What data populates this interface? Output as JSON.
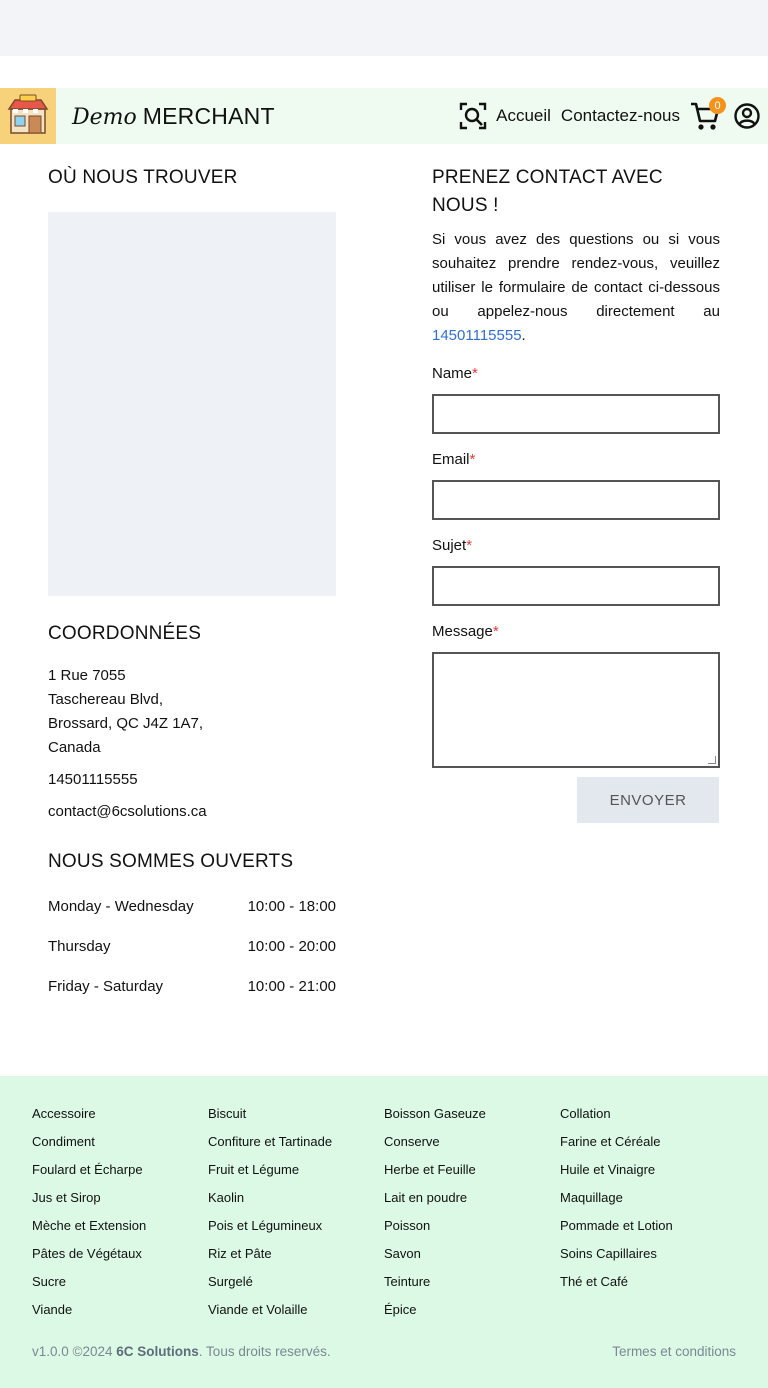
{
  "header": {
    "brand_script": "Demo",
    "brand_name": "MERCHANT",
    "nav": {
      "home": "Accueil",
      "contact": "Contactez-nous"
    },
    "cart_count": "0",
    "icons": [
      "store-logo-icon",
      "search-icon",
      "cart-icon",
      "account-icon"
    ]
  },
  "location": {
    "title": "OÙ NOUS TROUVER"
  },
  "coordinates": {
    "title": "COORDONNÉES",
    "address_line1": "1 Rue 7055",
    "address_line2": "Taschereau Blvd,",
    "address_line3": "Brossard, QC J4Z 1A7,",
    "address_line4": "Canada",
    "phone": "14501115555",
    "email": "contact@6csolutions.ca"
  },
  "hours": {
    "title": "NOUS SOMMES OUVERTS",
    "rows": [
      {
        "days": "Monday - Wednesday",
        "time": "10:00 - 18:00"
      },
      {
        "days": "Thursday",
        "time": "10:00 - 20:00"
      },
      {
        "days": "Friday - Saturday",
        "time": "10:00 - 21:00"
      }
    ]
  },
  "contact_form": {
    "title": "PRENEZ CONTACT AVEC NOUS !",
    "intro_text": "Si vous avez des questions ou si vous souhaitez prendre rendez-vous, veuillez utiliser le formulaire de contact ci-dessous ou appelez-nous directement au",
    "intro_phone": "14501115555",
    "intro_end": ".",
    "fields": {
      "name_label": "Name",
      "email_label": "Email",
      "subject_label": "Sujet",
      "message_label": "Message",
      "required_mark": "*"
    },
    "submit_label": "ENVOYER"
  },
  "footer": {
    "columns": [
      [
        "Accessoire",
        "Condiment",
        "Foulard et Écharpe",
        "Jus et Sirop",
        "Mèche et Extension",
        "Pâtes de Végétaux",
        "Sucre",
        "Viande"
      ],
      [
        "Biscuit",
        "Confiture et Tartinade",
        "Fruit et Légume",
        "Kaolin",
        "Pois et Légumineux",
        "Riz et Pâte",
        "Surgelé",
        "Viande et Volaille"
      ],
      [
        "Boisson Gaseuze",
        "Conserve",
        "Herbe et Feuille",
        "Lait en poudre",
        "Poisson",
        "Savon",
        "Teinture",
        "Épice"
      ],
      [
        "Collation",
        "Farine et Céréale",
        "Huile et Vinaigre",
        "Maquillage",
        "Pommade et Lotion",
        "Soins Capillaires",
        "Thé et Café"
      ]
    ],
    "version": "v1.0.0 ©2024",
    "company": "6C Solutions",
    "rights": ". Tous droits reservés.",
    "terms": "Termes et conditions"
  },
  "colors": {
    "navbar_bg": "#effbf1",
    "footer_bg": "#dcf9e5",
    "link": "#2f6fd6",
    "badge": "#f6931d",
    "required": "#e23b3b"
  }
}
